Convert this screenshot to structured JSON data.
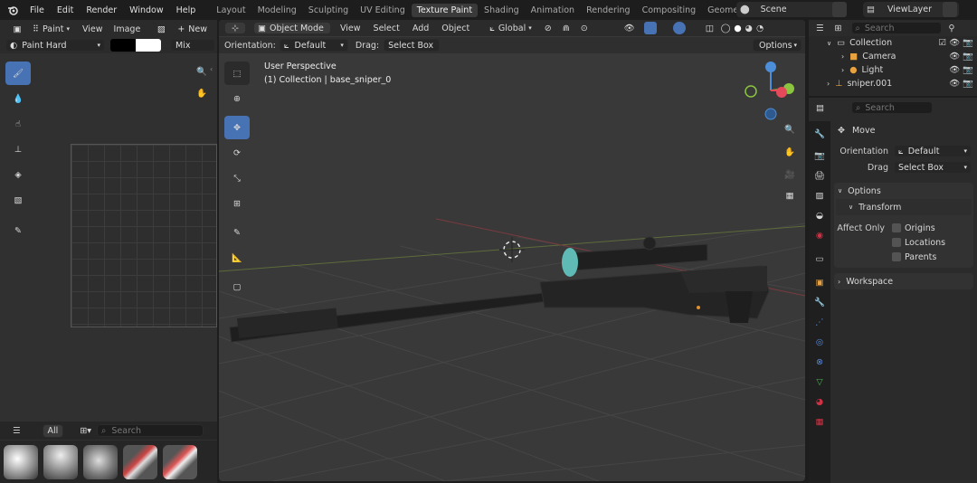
{
  "topbar": {
    "menus": [
      "File",
      "Edit",
      "Render",
      "Window",
      "Help"
    ],
    "workspaces": [
      "Layout",
      "Modeling",
      "Sculpting",
      "UV Editing",
      "Texture Paint",
      "Shading",
      "Animation",
      "Rendering",
      "Compositing",
      "Geometry Node"
    ],
    "active_workspace": "Texture Paint",
    "scene": "Scene",
    "view_layer": "ViewLayer"
  },
  "image_editor": {
    "mode": "Paint",
    "menus": [
      "View",
      "Image"
    ],
    "new_label": "New",
    "brush_name": "Paint Hard",
    "blend": "Mix",
    "search_placeholder": "Search",
    "filter_all": "All"
  },
  "viewport": {
    "mode": "Object Mode",
    "menus": [
      "View",
      "Select",
      "Add",
      "Object"
    ],
    "transform_orientation": "Global",
    "orientation_label": "Orientation:",
    "orientation_value": "Default",
    "drag_label": "Drag:",
    "drag_value": "Select Box",
    "options_label": "Options",
    "view_name": "User Perspective",
    "view_info": "(1) Collection | base_sniper_0"
  },
  "outliner": {
    "search_placeholder": "Search",
    "items": [
      {
        "label": "Collection",
        "level": 0,
        "icon": "collection-icon",
        "color": "#d8d8d8"
      },
      {
        "label": "Camera",
        "level": 1,
        "icon": "camera-icon",
        "color": "#d8d8d8"
      },
      {
        "label": "Light",
        "level": 1,
        "icon": "light-icon",
        "color": "#d8d8d8"
      },
      {
        "label": "sniper.001",
        "level": 0,
        "icon": "armature-icon",
        "color": "#d8d8d8"
      }
    ]
  },
  "properties": {
    "search_placeholder": "Search",
    "tool_name": "Move",
    "orientation_label": "Orientation",
    "orientation_value": "Default",
    "drag_label": "Drag",
    "drag_value": "Select Box",
    "options_section": "Options",
    "transform_section": "Transform",
    "affect_only_label": "Affect Only",
    "affect_options": [
      "Origins",
      "Locations",
      "Parents"
    ],
    "workspace_section": "Workspace"
  },
  "colors": {
    "accent": "#4772b3",
    "x_axis": "#e44a5a",
    "y_axis": "#8bc540",
    "z_axis": "#4c8ed8",
    "bg_dark": "#1d1d1d",
    "viewport_bg": "#393939"
  }
}
